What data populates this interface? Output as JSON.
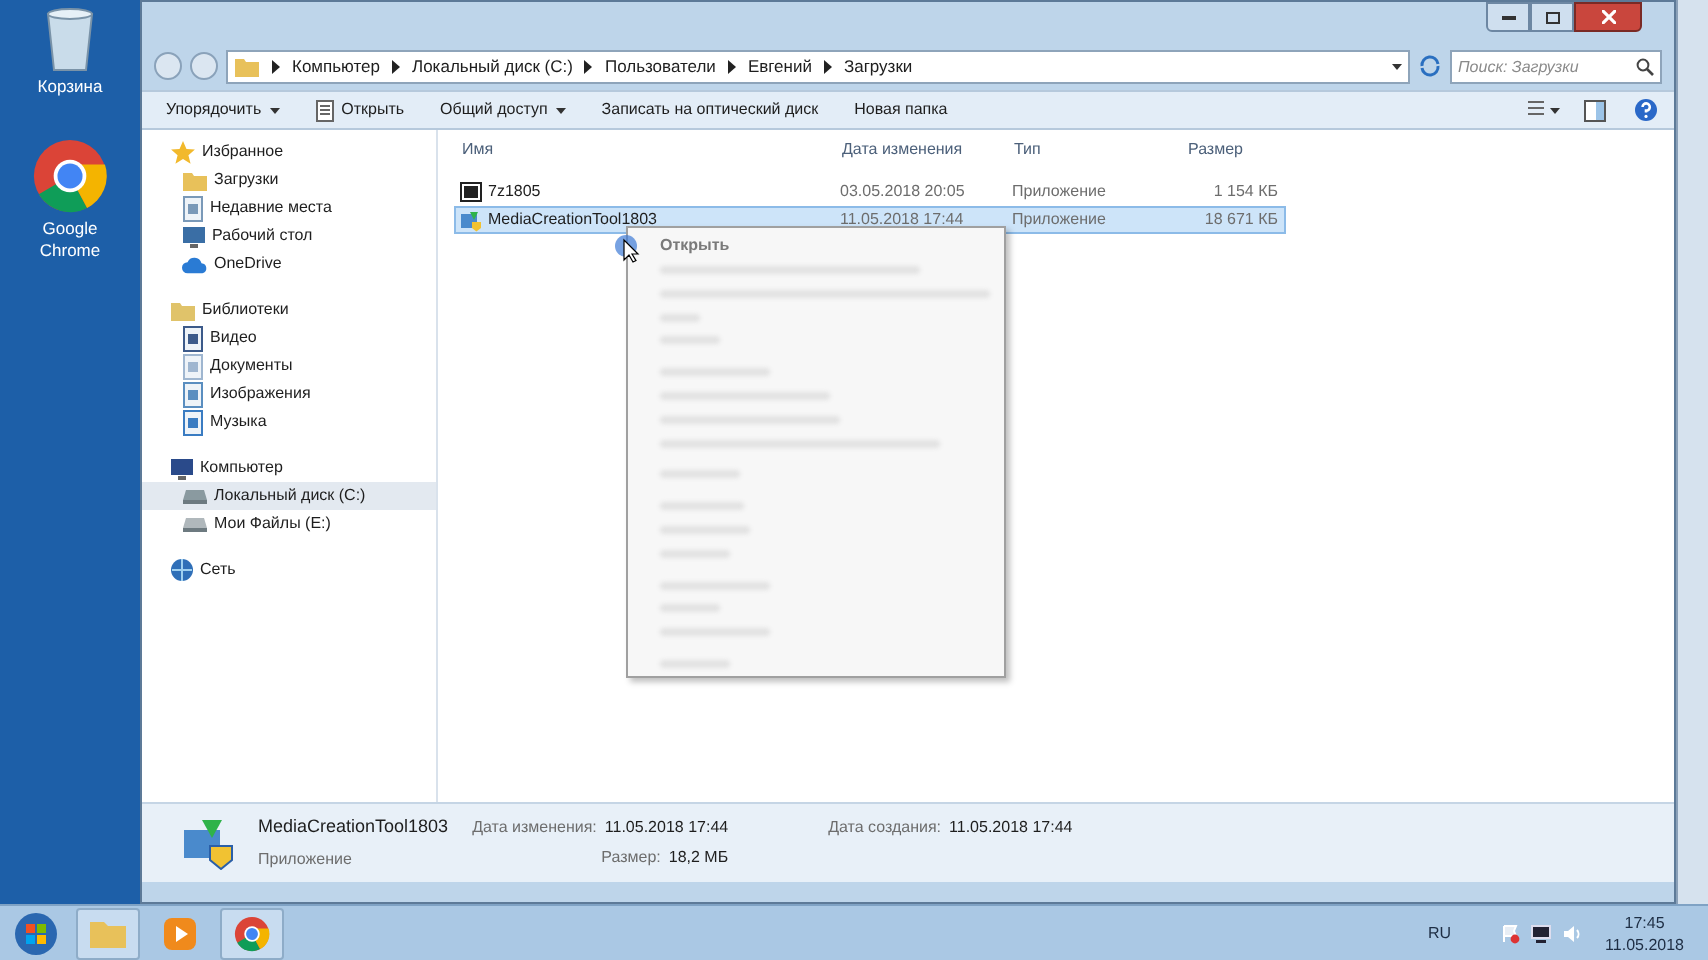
{
  "desktop_icons": [
    {
      "kind": "bin",
      "label": "Корзина"
    },
    {
      "kind": "chrome",
      "label": "Google Chrome"
    }
  ],
  "address_bar": {
    "path": [
      "Компьютер",
      "Локальный диск (C:)",
      "Пользователи",
      "Евгений",
      "Загрузки"
    ],
    "search": {
      "placeholder": "Поиск: Загрузки"
    }
  },
  "toolbar": [
    {
      "label": "Упорядочить",
      "dropdown": true,
      "icon": false
    },
    {
      "label": "Открыть",
      "dropdown": false,
      "icon": true
    },
    {
      "label": "Общий доступ",
      "dropdown": true,
      "icon": false
    },
    {
      "label": "Записать на оптический диск",
      "dropdown": false,
      "icon": false
    },
    {
      "label": "Новая папка",
      "dropdown": false,
      "icon": false
    }
  ],
  "navigation": [
    {
      "label": "Избранное",
      "kind": "star",
      "selected": false,
      "children": [
        {
          "label": "Загрузки",
          "kind": "folder",
          "selected": false
        },
        {
          "label": "Недавние места",
          "kind": "recent",
          "selected": false
        },
        {
          "label": "Рабочий стол",
          "kind": "desktop",
          "selected": false
        },
        {
          "label": "OneDrive",
          "kind": "cloud",
          "selected": false
        }
      ]
    },
    {
      "label": "Библиотеки",
      "kind": "library",
      "selected": false,
      "children": [
        {
          "label": "Видео",
          "kind": "video",
          "selected": false
        },
        {
          "label": "Документы",
          "kind": "docs",
          "selected": false
        },
        {
          "label": "Изображения",
          "kind": "images",
          "selected": false
        },
        {
          "label": "Музыка",
          "kind": "music",
          "selected": false
        }
      ]
    },
    {
      "label": "Компьютер",
      "kind": "computer",
      "selected": false,
      "children": [
        {
          "label": "Локальный диск (C:)",
          "kind": "drive",
          "selected": true
        },
        {
          "label": "Мои Файлы (E:)",
          "kind": "drive2",
          "selected": false
        }
      ]
    },
    {
      "label": "Сеть",
      "kind": "network",
      "selected": false
    }
  ],
  "file_list": {
    "columns": [
      "Имя",
      "Дата изменения",
      "Тип",
      "Размер"
    ],
    "rows": [
      {
        "kind": "archive",
        "name": "7z1805",
        "date": "03.05.2018 20:05",
        "type": "Приложение",
        "size": "1 154 КБ",
        "selected": false
      },
      {
        "kind": "setup",
        "name": "MediaCreationTool1803",
        "date": "11.05.2018 17:44",
        "type": "Приложение",
        "size": "18 671 КБ",
        "selected": true
      }
    ]
  },
  "context_menu": {
    "first_item": "Открыть"
  },
  "details": {
    "name": "MediaCreationTool1803",
    "type": "Приложение",
    "fields": [
      {
        "label": "Дата изменения:",
        "value": "11.05.2018 17:44"
      },
      {
        "label": "Дата создания:",
        "value": "11.05.2018 17:44"
      },
      {
        "label": "Размер:",
        "value": "18,2 МБ"
      }
    ]
  },
  "taskbar": {
    "apps": [
      {
        "kind": "explorer"
      },
      {
        "kind": "player"
      },
      {
        "kind": "chrome"
      }
    ],
    "language": "RU",
    "time": "17:45",
    "date": "11.05.2018"
  }
}
